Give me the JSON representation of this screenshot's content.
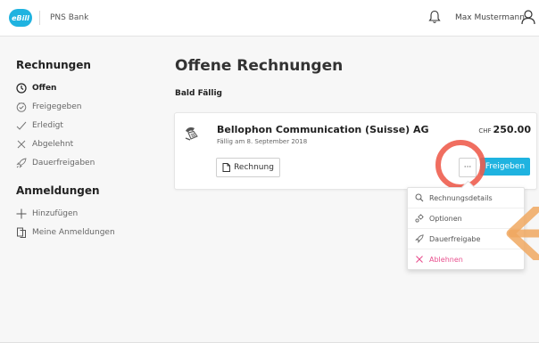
{
  "header": {
    "logo_text": "eBill",
    "bank_name": "PNS Bank",
    "user_name": "Max Mustermann"
  },
  "sidebar": {
    "section1_title": "Rechnungen",
    "items1": [
      {
        "label": "Offen",
        "icon": "clock-icon",
        "active": true
      },
      {
        "label": "Freigegeben",
        "icon": "calendar-check-icon",
        "active": false
      },
      {
        "label": "Erledigt",
        "icon": "check-icon",
        "active": false
      },
      {
        "label": "Abgelehnt",
        "icon": "close-icon",
        "active": false
      },
      {
        "label": "Dauerfreigaben",
        "icon": "rocket-icon",
        "active": false
      }
    ],
    "section2_title": "Anmeldungen",
    "items2": [
      {
        "label": "Hinzufügen",
        "icon": "plus-icon"
      },
      {
        "label": "Meine Anmeldungen",
        "icon": "documents-icon"
      }
    ]
  },
  "main": {
    "title": "Offene Rechnungen",
    "section_title": "Bald Fällig",
    "invoice": {
      "company": "Bellophon Communication (Suisse) AG",
      "due": "Fällig am 8. September 2018",
      "currency": "CHF",
      "amount": "250.00",
      "rechnung_label": "Rechnung",
      "more_label": "···",
      "approve_label": "Freigeben"
    },
    "menu": [
      {
        "label": "Rechnungsdetails",
        "icon": "search-icon"
      },
      {
        "label": "Optionen",
        "icon": "gear-icon"
      },
      {
        "label": "Dauerfreigabe",
        "icon": "rocket-icon"
      },
      {
        "label": "Ablehnen",
        "icon": "close-icon"
      }
    ]
  },
  "colors": {
    "accent": "#1fb3e0",
    "highlight_circle": "#ee5a4a",
    "arrow": "#f0a860",
    "danger": "#e8508e"
  }
}
